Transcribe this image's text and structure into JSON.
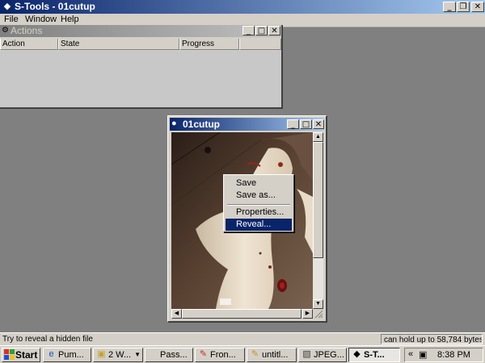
{
  "app": {
    "title": "S-Tools - 01cutup",
    "icon": "s-tools-icon"
  },
  "menu": {
    "items": [
      "File",
      "Window",
      "Help"
    ]
  },
  "actions_window": {
    "title": "Actions",
    "columns": [
      "Action",
      "State",
      "Progress"
    ]
  },
  "image_window": {
    "title": "01cutup"
  },
  "context_menu": {
    "items": [
      "Save",
      "Save as...",
      "Properties...",
      "Reveal..."
    ],
    "selected": "Reveal..."
  },
  "status_bar": {
    "left": "Try to reveal a hidden file",
    "right": "can hold up to 58,784 bytes"
  },
  "taskbar": {
    "start_label": "Start",
    "buttons": [
      {
        "label": "Pum...",
        "icon": "ie-icon"
      },
      {
        "label": "2 W...",
        "icon": "folder-icon"
      },
      {
        "label": "Pass...",
        "icon": "blank-icon"
      },
      {
        "label": "Fron...",
        "icon": "frontpage-icon"
      },
      {
        "label": "untitl...",
        "icon": "paint-icon"
      },
      {
        "label": "JPEG...",
        "icon": "jpeg-icon"
      },
      {
        "label": "S-T...",
        "icon": "s-tools-icon",
        "active": true
      }
    ],
    "tray_expand": "«",
    "clock": "8:38 PM"
  },
  "colors": {
    "active_title_start": "#0a246a",
    "active_title_end": "#a6caf0",
    "inactive_title_start": "#808080",
    "menu_highlight": "#0a246a",
    "chrome": "#d4d0c8",
    "desktop": "#808080"
  }
}
